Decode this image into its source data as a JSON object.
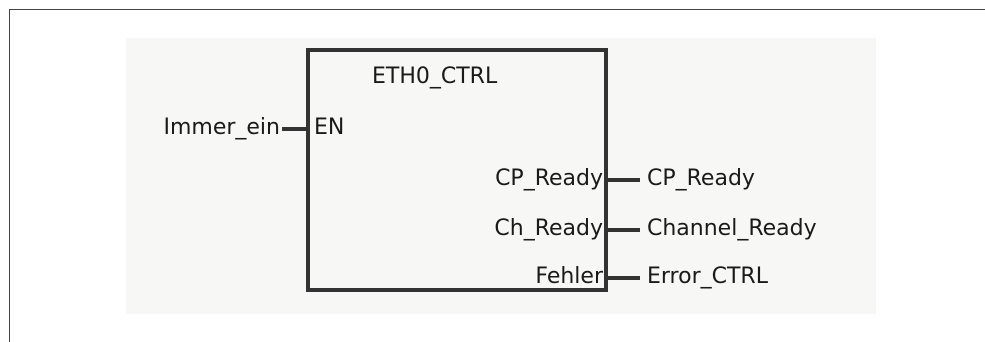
{
  "block": {
    "title": "ETH0_CTRL",
    "input_pin": "EN",
    "output_pins": [
      "CP_Ready",
      "Ch_Ready",
      "Fehler"
    ]
  },
  "input_signal": "Immer_ein",
  "output_signals": [
    "CP_Ready",
    "Channel_Ready",
    "Error_CTRL"
  ],
  "colors": {
    "background": "#f7f7f5",
    "line": "#333333"
  }
}
